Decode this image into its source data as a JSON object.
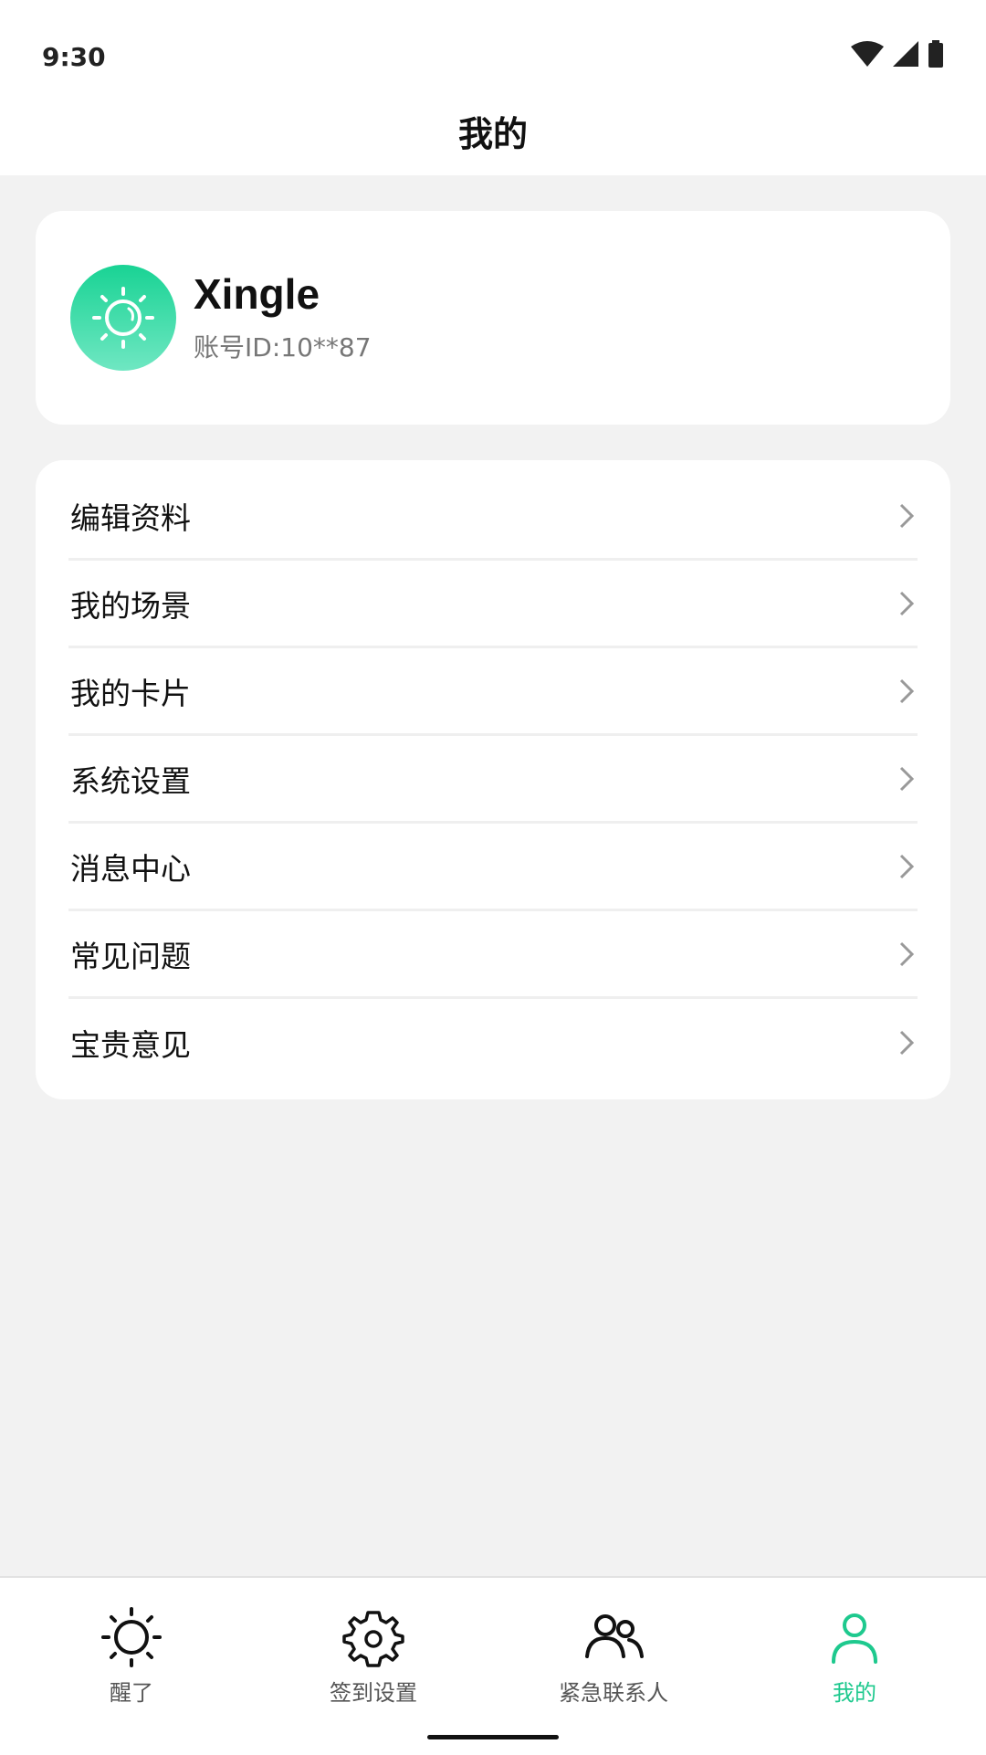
{
  "status_bar": {
    "time": "9:30"
  },
  "header": {
    "title": "我的"
  },
  "profile": {
    "name": "Xingle",
    "account_id": "账号ID:10**87"
  },
  "menu": {
    "items": [
      {
        "label": "编辑资料"
      },
      {
        "label": "我的场景"
      },
      {
        "label": "我的卡片"
      },
      {
        "label": "系统设置"
      },
      {
        "label": "消息中心"
      },
      {
        "label": "常见问题"
      },
      {
        "label": "宝贵意见"
      }
    ]
  },
  "bottom_nav": {
    "tabs": [
      {
        "label": "醒了",
        "icon": "sun-icon"
      },
      {
        "label": "签到设置",
        "icon": "gear-icon"
      },
      {
        "label": "紧急联系人",
        "icon": "contacts-icon"
      },
      {
        "label": "我的",
        "icon": "user-icon",
        "active": true
      }
    ]
  },
  "colors": {
    "accent": "#1ec98e",
    "background": "#f2f2f2",
    "card": "#ffffff"
  }
}
